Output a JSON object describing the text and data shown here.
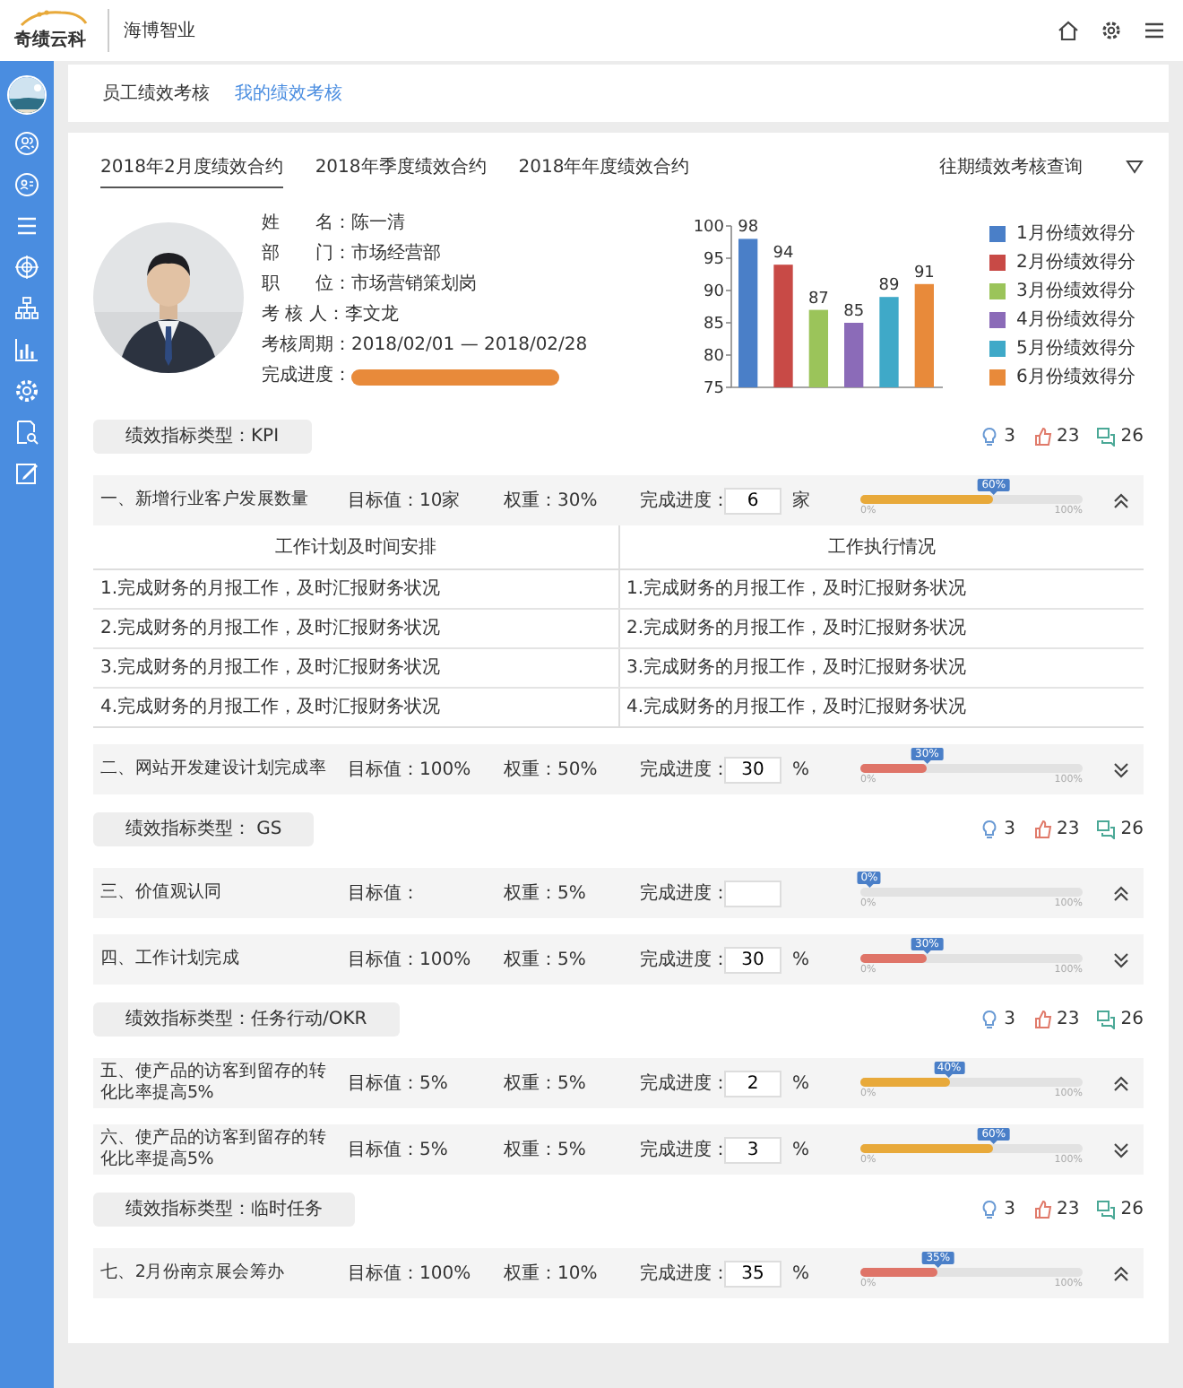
{
  "header": {
    "logo": "奇绩云科",
    "company": "海博智业"
  },
  "subnav": [
    {
      "label": "员工绩效考核",
      "selected": false
    },
    {
      "label": "我的绩效考核",
      "selected": true
    }
  ],
  "tabs": [
    {
      "label": "2018年2月度绩效合约",
      "selected": true
    },
    {
      "label": "2018年季度绩效合约",
      "selected": false
    },
    {
      "label": "2018年年度绩效合约",
      "selected": false
    }
  ],
  "history_query": "往期绩效考核查询",
  "profile": {
    "lines": [
      "姓　　名：陈一清",
      "部　　门：市场经营部",
      "职　　位：市场营销策划岗",
      "考 核 人：李文龙",
      "考核周期：2018/02/01 — 2018/02/28"
    ],
    "progress_label": "完成进度：",
    "progress": {
      "level": 1
    }
  },
  "chart_data": {
    "type": "bar",
    "legend": true,
    "ylim": [
      75,
      100
    ],
    "yticks": [
      75,
      80,
      85,
      90,
      95,
      100
    ],
    "data_labels": true,
    "series": [
      {
        "name": "1月份绩效得分",
        "color": "#4a7fc8",
        "values": [
          98
        ]
      },
      {
        "name": "2月份绩效得分",
        "color": "#c84a46",
        "values": [
          94
        ]
      },
      {
        "name": "3月份绩效得分",
        "color": "#9bc45a",
        "values": [
          87
        ]
      },
      {
        "name": "4月份绩效得分",
        "color": "#8b6bb8",
        "values": [
          85
        ]
      },
      {
        "name": "5月份绩效得分",
        "color": "#3fa9c8",
        "values": [
          89
        ]
      },
      {
        "name": "6月份绩效得分",
        "color": "#e88a3a",
        "values": [
          91
        ]
      }
    ]
  },
  "categories": [
    {
      "title": "绩效指标类型：KPI",
      "stats": {
        "ideas": "3",
        "likes": "23",
        "comments": "26"
      },
      "rows": [
        {
          "name": "一、新增行业客户发展数量",
          "target": "目标值：10家",
          "weight": "权重：30%",
          "progress_label": "完成进度：",
          "value": "6",
          "unit": "家",
          "level": 0.6,
          "bubble": "60%",
          "scale_min": "0%",
          "scale_max": "100%",
          "color": "#e8a93a",
          "expanded": true,
          "details": {
            "columns": [
              "工作计划及时间安排",
              "工作执行情况"
            ],
            "rows": [
              [
                "1.完成财务的月报工作，及时汇报财务状况",
                "1.完成财务的月报工作，及时汇报财务状况"
              ],
              [
                "2.完成财务的月报工作，及时汇报财务状况",
                "2.完成财务的月报工作，及时汇报财务状况"
              ],
              [
                "3.完成财务的月报工作，及时汇报财务状况",
                "3.完成财务的月报工作，及时汇报财务状况"
              ],
              [
                "4.完成财务的月报工作，及时汇报财务状况",
                "4.完成财务的月报工作，及时汇报财务状况"
              ]
            ]
          }
        },
        {
          "name": "二、网站开发建设计划完成率",
          "target": "目标值：100%",
          "weight": "权重：50%",
          "progress_label": "完成进度：",
          "value": "30",
          "unit": "%",
          "level": 0.3,
          "bubble": "30%",
          "scale_min": "0%",
          "scale_max": "100%",
          "color": "#df7468",
          "expanded": false
        }
      ]
    },
    {
      "title": "绩效指标类型： GS",
      "stats": {
        "ideas": "3",
        "likes": "23",
        "comments": "26"
      },
      "rows": [
        {
          "name": "三、价值观认同",
          "target": "目标值：",
          "weight": "权重：5%",
          "progress_label": "完成进度：",
          "bubble": "0%",
          "scale_min": "0%",
          "scale_max": "100%",
          "expanded": true
        },
        {
          "name": "四、工作计划完成",
          "target": "目标值：100%",
          "weight": "权重：5%",
          "progress_label": "完成进度：",
          "value": "30",
          "unit": "%",
          "level": 0.3,
          "bubble": "30%",
          "scale_min": "0%",
          "scale_max": "100%",
          "color": "#df7468",
          "expanded": false
        }
      ]
    },
    {
      "title": "绩效指标类型：任务行动/OKR",
      "stats": {
        "ideas": "3",
        "likes": "23",
        "comments": "26"
      },
      "rows": [
        {
          "name": "五、使产品的访客到留存的转化比率提高5%",
          "target": "目标值：5%",
          "weight": "权重：5%",
          "progress_label": "完成进度：",
          "value": "2",
          "unit": "%",
          "level": 0.4,
          "bubble": "40%",
          "scale_min": "0%",
          "scale_max": "100%",
          "color": "#e8a93a",
          "expanded": true
        },
        {
          "name": "六、使产品的访客到留存的转化比率提高5%",
          "target": "目标值：5%",
          "weight": "权重：5%",
          "progress_label": "完成进度：",
          "value": "3",
          "unit": "%",
          "level": 0.6,
          "bubble": "60%",
          "scale_min": "0%",
          "scale_max": "100%",
          "color": "#e8a93a",
          "expanded": false
        }
      ]
    },
    {
      "title": "绩效指标类型：临时任务",
      "stats": {
        "ideas": "3",
        "likes": "23",
        "comments": "26"
      },
      "rows": [
        {
          "name": "七、2月份南京展会筹办",
          "target": "目标值：100%",
          "weight": "权重：10%",
          "progress_label": "完成进度：",
          "value": "35",
          "unit": "%",
          "level": 0.35,
          "bubble": "35%",
          "scale_min": "0%",
          "scale_max": "100%",
          "color": "#df7468",
          "expanded": true
        }
      ]
    }
  ]
}
